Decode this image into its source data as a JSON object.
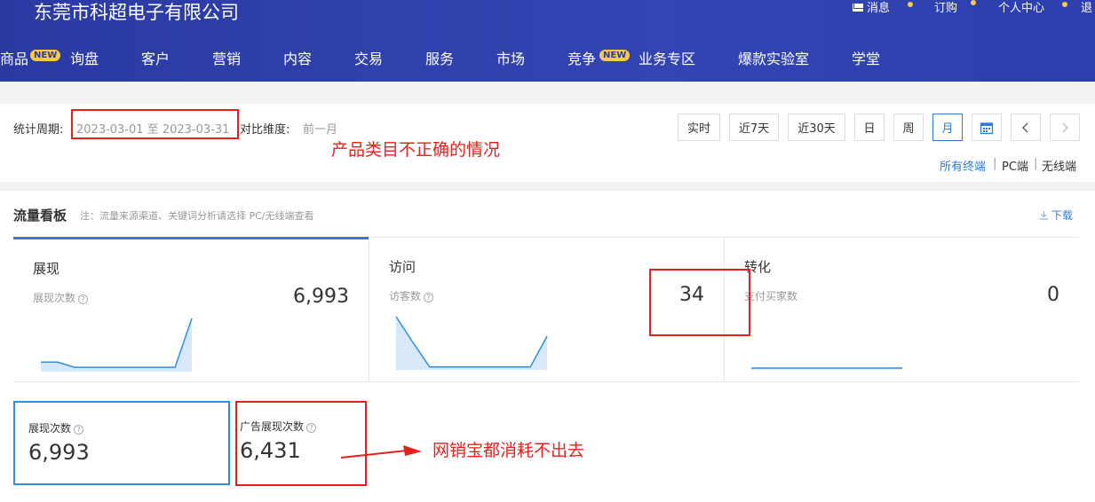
{
  "header": {
    "company": "东莞市科超电子有限公司",
    "top_links": [
      "消息",
      "订购",
      "个人中心",
      "退"
    ],
    "nav": [
      {
        "label": "商品",
        "badge": "NEW"
      },
      {
        "label": "询盘"
      },
      {
        "label": "客户"
      },
      {
        "label": "营销"
      },
      {
        "label": "内容"
      },
      {
        "label": "交易"
      },
      {
        "label": "服务"
      },
      {
        "label": "市场"
      },
      {
        "label": "竞争",
        "badge": "NEW"
      },
      {
        "label": "业务专区"
      },
      {
        "label": "爆款实验室"
      },
      {
        "label": "学堂"
      }
    ],
    "colors": {
      "bg": "#2f3ea8",
      "badge": "#f7c948"
    }
  },
  "toolbar": {
    "period_label": "统计周期:",
    "period_value": "2023-03-01 至 2023-03-31",
    "compare_label": "对比维度:",
    "compare_value": "前一月",
    "buttons": [
      "实时",
      "近7天",
      "近30天",
      "日",
      "周",
      "月"
    ],
    "active_button": "月",
    "calendar_icon": "calendar-icon",
    "prev_icon": "chevron-left-icon",
    "next_icon": "chevron-right-icon",
    "terminals": [
      "所有终端",
      "PC端",
      "无线端"
    ],
    "separator": "|"
  },
  "annotations": {
    "category_note": "产品类目不正确的情况",
    "ad_note": "网销宝都消耗不出去"
  },
  "flow": {
    "title": "流量看板",
    "note": "注：流量来源渠道、关键词分析请选择 PC/无线端查看",
    "download": "下载",
    "cards": [
      {
        "title": "展现",
        "metric": "展现次数",
        "value": "6,993",
        "spark": [
          0.15,
          0.15,
          0.05,
          0.05,
          0.05,
          0.05,
          0.05,
          0.05,
          0.05,
          1.0
        ]
      },
      {
        "title": "访问",
        "metric": "访客数",
        "value": "34",
        "spark": [
          1.0,
          0.5,
          0.02,
          0.02,
          0.02,
          0.02,
          0.02,
          0.02,
          0.02,
          0.62
        ]
      },
      {
        "title": "转化",
        "metric": "支付买家数",
        "value": "0",
        "spark": [
          0.0,
          0.0,
          0.0,
          0.0,
          0.0,
          0.0,
          0.0,
          0.0,
          0.0,
          0.0
        ]
      }
    ],
    "mini": [
      {
        "label": "展现次数",
        "value": "6,993"
      },
      {
        "label": "广告展现次数",
        "value": "6,431"
      }
    ]
  }
}
